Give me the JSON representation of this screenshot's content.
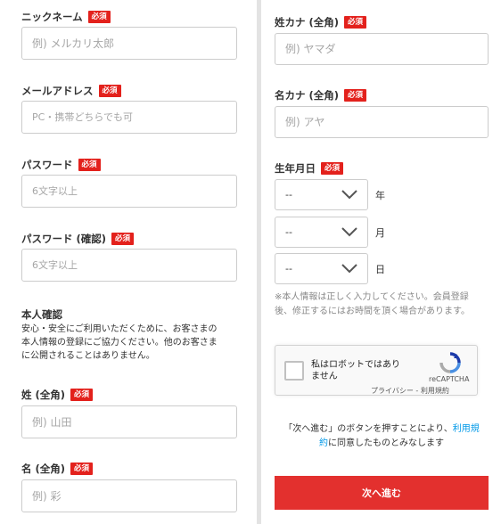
{
  "required_badge": "必須",
  "left": {
    "nickname": {
      "label": "ニックネーム",
      "placeholder": "例) メルカリ太郎"
    },
    "email": {
      "label": "メールアドレス",
      "placeholder": "PC・携帯どちらでも可"
    },
    "password": {
      "label": "パスワード",
      "placeholder": "6文字以上"
    },
    "password_confirm": {
      "label": "パスワード (確認)",
      "placeholder": "6文字以上"
    },
    "identity": {
      "heading": "本人確認",
      "note_lines": [
        "安心・安全にご利用いただくために、お客さまの",
        "本人情報の登録にご協力ください。他のお客さま",
        "に公開されることはありません。"
      ]
    },
    "last_name": {
      "label": "姓 (全角)",
      "placeholder": "例) 山田"
    },
    "first_name": {
      "label": "名 (全角)",
      "placeholder": "例) 彩"
    }
  },
  "right": {
    "last_name_kana": {
      "label": "姓カナ (全角)",
      "placeholder": "例) ヤマダ"
    },
    "first_name_kana": {
      "label": "名カナ (全角)",
      "placeholder": "例) アヤ"
    },
    "birthday": {
      "label": "生年月日",
      "year": {
        "value": "--",
        "unit": "年"
      },
      "month": {
        "value": "--",
        "unit": "月"
      },
      "day": {
        "value": "--",
        "unit": "日"
      },
      "note_lines": [
        "※本人情報は正しく入力してください。会員登録",
        "後、修正するにはお時間を頂く場合があります。"
      ]
    },
    "recaptcha": {
      "label_lines": [
        "私はロボットではあり",
        "ません"
      ],
      "brand": "reCAPTCHA",
      "privacy": "プライバシー",
      "separator": " - ",
      "terms": "利用規約"
    },
    "consent": {
      "line1_text": "「次へ進む」のボタンを押すことにより、",
      "line1_link": "利用規",
      "line2_link": "約",
      "line2_text": "に同意したものとみなします"
    },
    "submit_label": "次へ進む"
  },
  "colors": {
    "required": "#e3211c",
    "submit": "#e3302e",
    "link": "#0099e8",
    "divider": "#e3e3e3"
  },
  "icons": {
    "select_arrow": "chevron-down-icon",
    "recaptcha": "recaptcha-logo-icon"
  }
}
